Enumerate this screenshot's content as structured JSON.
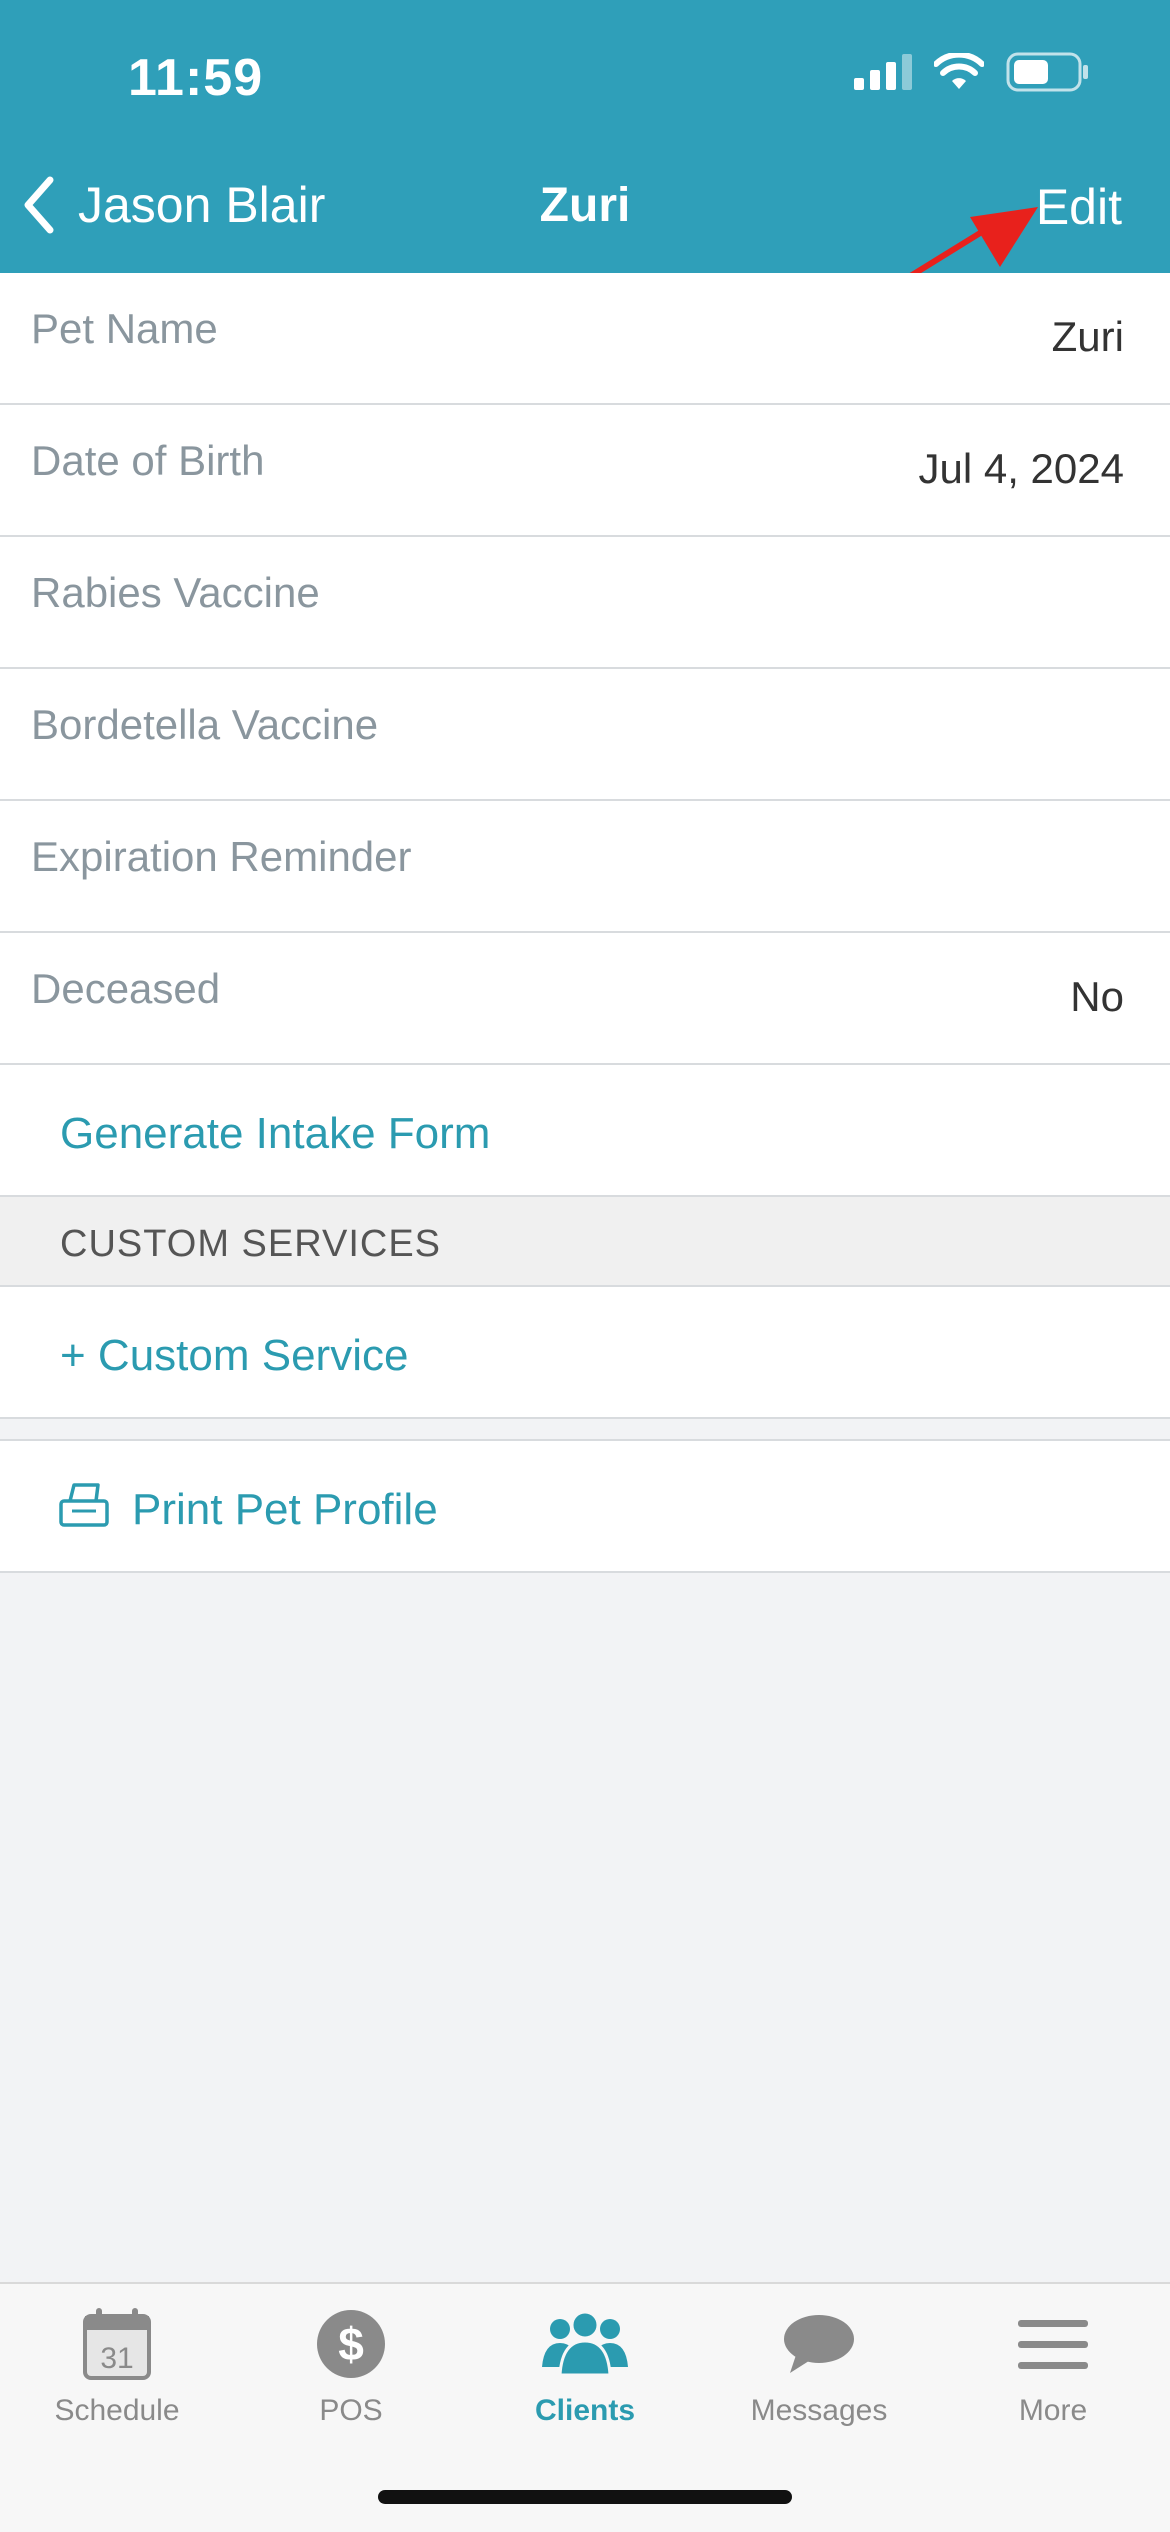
{
  "status_bar": {
    "time": "11:59"
  },
  "nav": {
    "back_label": "Jason Blair",
    "title": "Zuri",
    "edit_label": "Edit"
  },
  "rows": [
    {
      "label": "Pet Name",
      "value": "Zuri"
    },
    {
      "label": "Date of Birth",
      "value": "Jul 4, 2024"
    },
    {
      "label": "Rabies Vaccine",
      "value": ""
    },
    {
      "label": "Bordetella Vaccine",
      "value": ""
    },
    {
      "label": "Expiration Reminder",
      "value": ""
    },
    {
      "label": "Deceased",
      "value": "No"
    }
  ],
  "actions": {
    "intake_form": "Generate Intake Form",
    "custom_services_header": "CUSTOM SERVICES",
    "add_custom_service": "+ Custom Service",
    "print_profile": "Print Pet Profile"
  },
  "tabs": [
    {
      "label": "Schedule",
      "icon": "calendar-icon",
      "badge": "31"
    },
    {
      "label": "POS",
      "icon": "dollar-icon",
      "glyph": "$"
    },
    {
      "label": "Clients",
      "icon": "clients-icon",
      "active": true
    },
    {
      "label": "Messages",
      "icon": "speech-bubble-icon"
    },
    {
      "label": "More",
      "icon": "menu-icon"
    }
  ],
  "colors": {
    "brand": "#2f9fb9",
    "link": "#2b9bb0",
    "annotation": "#e8211c"
  }
}
